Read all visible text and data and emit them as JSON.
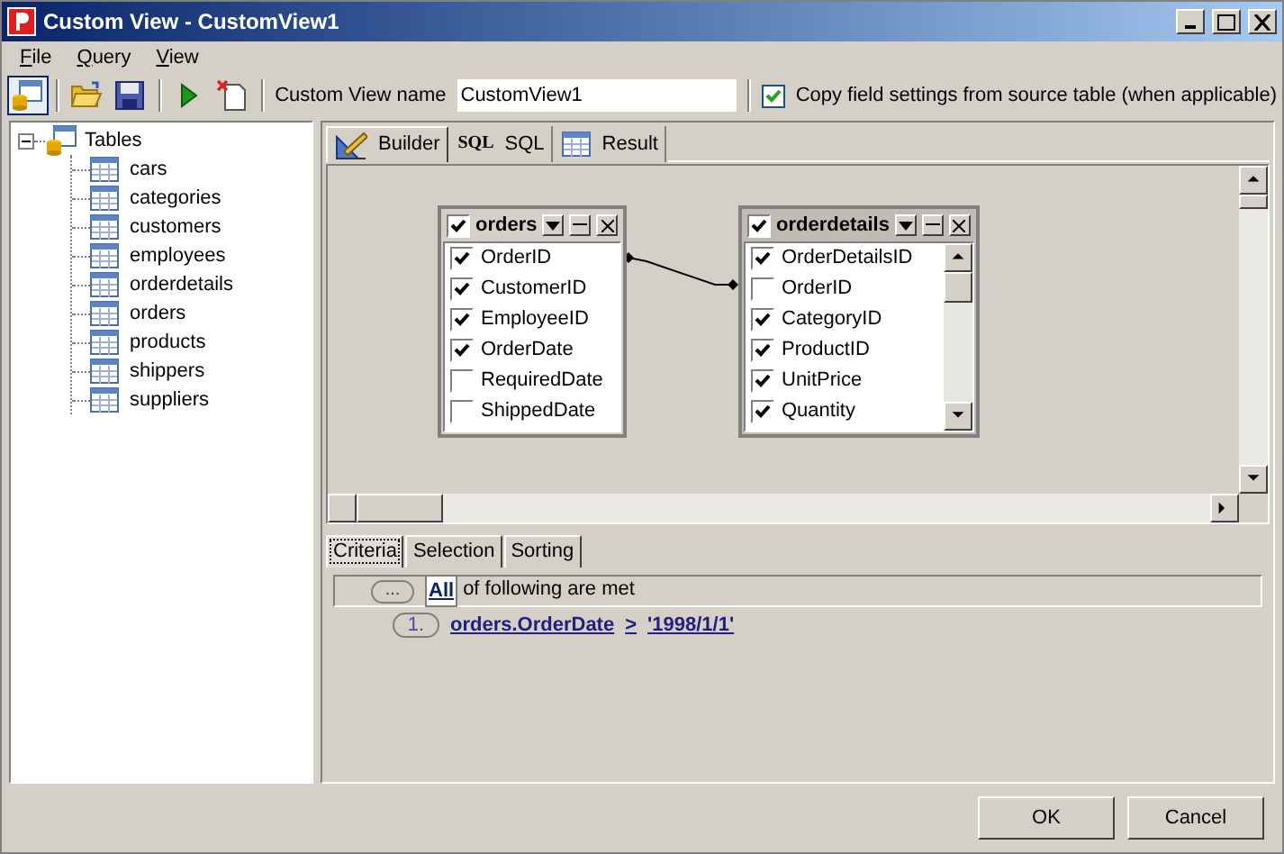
{
  "window": {
    "title": "Custom View - CustomView1"
  },
  "menu": [
    "File",
    "Query",
    "View"
  ],
  "toolbar": [
    {
      "kind": "tables",
      "pressed": true
    },
    {
      "kind": "open",
      "pressed": false
    },
    {
      "kind": "save",
      "pressed": false
    },
    {
      "kind": "run",
      "pressed": false
    },
    {
      "kind": "new",
      "pressed": false
    }
  ],
  "view_name": {
    "label": "Custom View name",
    "value": "CustomView1"
  },
  "copy_settings": {
    "label": "Copy field settings from source table (when applicable)",
    "checked": true
  },
  "tree": {
    "label": "Tables",
    "expanded": true,
    "children": [
      {
        "label": "cars"
      },
      {
        "label": "categories"
      },
      {
        "label": "customers"
      },
      {
        "label": "employees"
      },
      {
        "label": "orderdetails"
      },
      {
        "label": "orders"
      },
      {
        "label": "products"
      },
      {
        "label": "shippers"
      },
      {
        "label": "suppliers"
      }
    ]
  },
  "tabs": [
    {
      "kind": "builder",
      "label": "Builder",
      "selected": true
    },
    {
      "kind": "sql",
      "icon_text": "SQL",
      "label": "SQL",
      "selected": false
    },
    {
      "kind": "result",
      "label": "Result",
      "selected": false
    }
  ],
  "tables": [
    {
      "name": "orders",
      "checked": true,
      "selected": false,
      "scrollable": false,
      "fields": [
        {
          "name": "OrderID",
          "checked": true
        },
        {
          "name": "CustomerID",
          "checked": true
        },
        {
          "name": "EmployeeID",
          "checked": true
        },
        {
          "name": "OrderDate",
          "checked": true
        },
        {
          "name": "RequiredDate",
          "checked": false
        },
        {
          "name": "ShippedDate",
          "checked": false
        }
      ]
    },
    {
      "name": "orderdetails",
      "checked": true,
      "selected": true,
      "scrollable": true,
      "fields": [
        {
          "name": "OrderDetailsID",
          "checked": true
        },
        {
          "name": "OrderID",
          "checked": false
        },
        {
          "name": "CategoryID",
          "checked": true
        },
        {
          "name": "ProductID",
          "checked": true
        },
        {
          "name": "UnitPrice",
          "checked": true
        },
        {
          "name": "Quantity",
          "checked": true
        }
      ]
    }
  ],
  "criteria_tabs": [
    {
      "label": "Criteria",
      "selected": true
    },
    {
      "label": "Selection",
      "selected": false
    },
    {
      "label": "Sorting",
      "selected": false
    }
  ],
  "criteria": {
    "button": "...",
    "quantifier": "All",
    "text": "of following are met",
    "conditions": [
      {
        "number": "1.",
        "field": "orders.OrderDate",
        "operator": ">",
        "value": "'1998/1/1'"
      }
    ]
  },
  "buttons": [
    "OK",
    "Cancel"
  ]
}
